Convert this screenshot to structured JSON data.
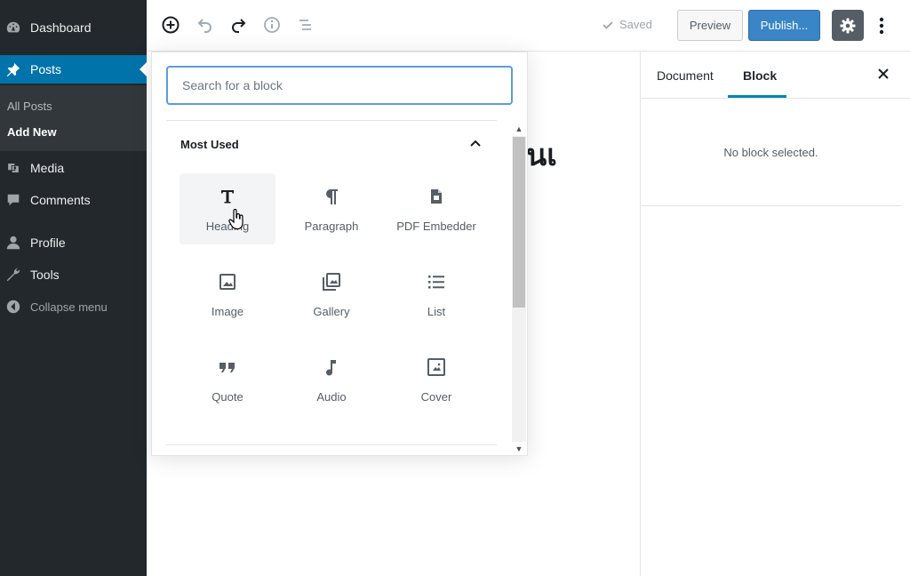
{
  "admin_menu": {
    "items": [
      {
        "label": "Dashboard",
        "icon": "dashboard-icon"
      },
      {
        "label": "Posts",
        "icon": "pin-icon",
        "active": true
      },
      {
        "label": "Media",
        "icon": "media-icon"
      },
      {
        "label": "Comments",
        "icon": "comment-icon"
      },
      {
        "label": "Profile",
        "icon": "user-icon"
      },
      {
        "label": "Tools",
        "icon": "wrench-icon"
      },
      {
        "label": "Collapse menu",
        "icon": "collapse-arrow-icon"
      }
    ],
    "submenu": [
      "All Posts",
      "Add New"
    ]
  },
  "toolbar": {
    "saved_label": "Saved",
    "preview_label": "Preview",
    "publish_label": "Publish..."
  },
  "settings_sidebar": {
    "tabs": [
      "Document",
      "Block"
    ],
    "active_tab": "Block",
    "empty_message": "No block selected."
  },
  "editor": {
    "title_fragment": "นเ"
  },
  "inserter": {
    "search_placeholder": "Search for a block",
    "panel_title": "Most Used",
    "blocks": [
      {
        "label": "Heading",
        "icon": "heading-icon"
      },
      {
        "label": "Paragraph",
        "icon": "paragraph-icon"
      },
      {
        "label": "PDF Embedder",
        "icon": "pdf-file-icon"
      },
      {
        "label": "Image",
        "icon": "image-icon"
      },
      {
        "label": "Gallery",
        "icon": "gallery-icon"
      },
      {
        "label": "List",
        "icon": "list-icon"
      },
      {
        "label": "Quote",
        "icon": "quote-icon"
      },
      {
        "label": "Audio",
        "icon": "music-note-icon"
      },
      {
        "label": "Cover",
        "icon": "cover-icon"
      }
    ]
  },
  "colors": {
    "sidebar_bg": "#23282d",
    "active_menu": "#0073aa",
    "publish_button": "#3a85c5",
    "focus_border": "#5b9dd9"
  }
}
